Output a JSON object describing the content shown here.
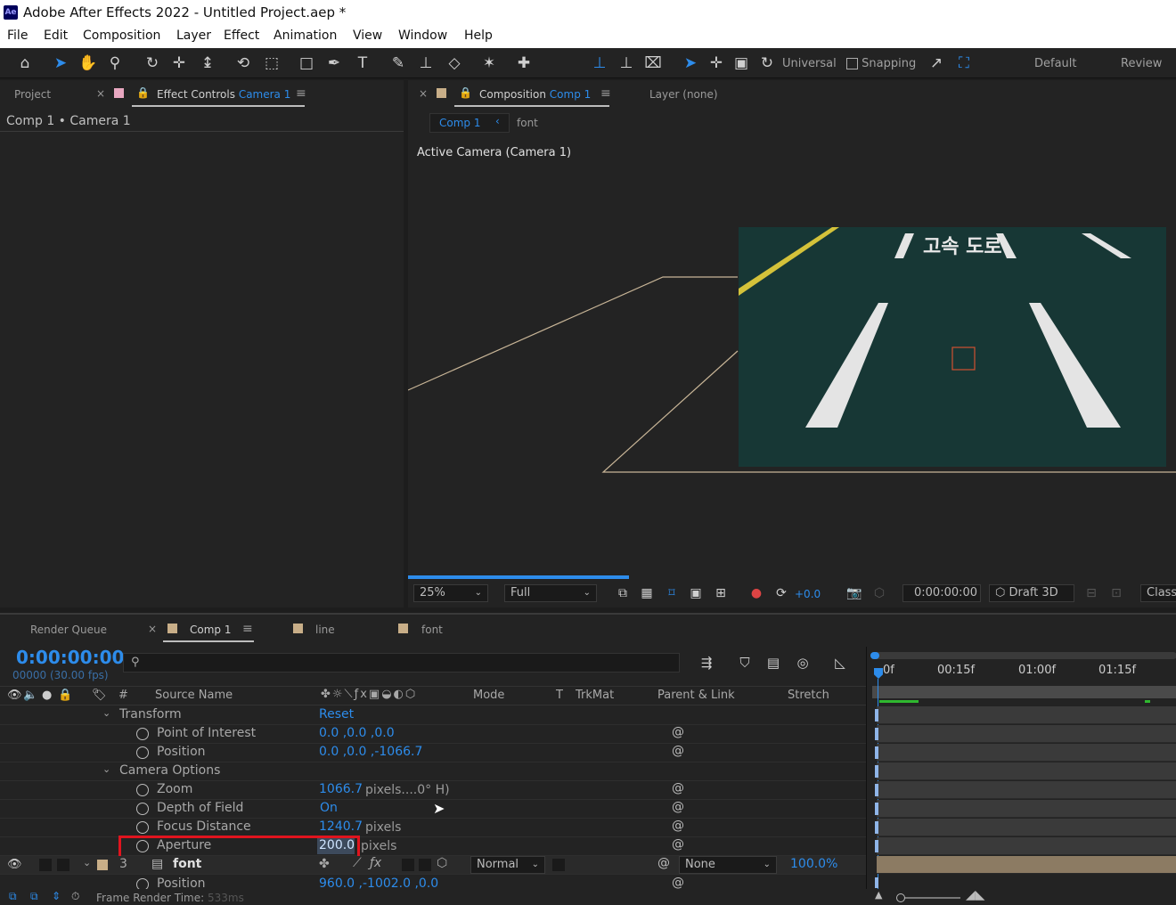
{
  "app": {
    "title": "Adobe After Effects 2022 - Untitled Project.aep *",
    "icon_label": "Ae"
  },
  "menu": [
    "File",
    "Edit",
    "Composition",
    "Layer",
    "Effect",
    "Animation",
    "View",
    "Window",
    "Help"
  ],
  "toolbar": {
    "universal_label": "Universal",
    "snapping_label": "Snapping",
    "workspaces": [
      "Default",
      "Review"
    ]
  },
  "left_panel": {
    "project_tab": "Project",
    "effect_controls_tab": "Effect Controls",
    "effect_controls_target": "Camera 1",
    "subtitle": "Comp 1 • Camera 1"
  },
  "comp_panel": {
    "tab_label": "Composition",
    "tab_target": "Comp 1",
    "layer_tab": "Layer (none)",
    "breadcrumb_active": "Comp 1",
    "breadcrumb_next": "font",
    "viewer_label": "Active Camera (Camera 1)",
    "road_text": "고속 도로",
    "zoom": "25%",
    "resolution": "Full",
    "exposure": "+0.0",
    "timecode": "0:00:00:00",
    "renderer": "Draft 3D",
    "classic_label": "Classi"
  },
  "timeline": {
    "tabs": {
      "render_queue": "Render Queue",
      "comp": "Comp 1",
      "line": "line",
      "font": "font"
    },
    "current_time": "0:00:00:00",
    "frame_info": "00000 (30.00 fps)",
    "columns": {
      "hash": "#",
      "source_name": "Source Name",
      "mode": "Mode",
      "t": "T",
      "trkmat": "TrkMat",
      "parent": "Parent & Link",
      "stretch": "Stretch"
    },
    "ruler": [
      "0f",
      "00:15f",
      "01:00f",
      "01:15f"
    ],
    "properties": [
      {
        "name": "Transform",
        "value": "Reset",
        "group": true
      },
      {
        "name": "Point of Interest",
        "value": "0.0 ,0.0 ,0.0"
      },
      {
        "name": "Position",
        "value": "0.0 ,0.0 ,-1066.7"
      },
      {
        "name": "Camera Options",
        "group": true
      },
      {
        "name": "Zoom",
        "value": "1066.7",
        "suffix": "pixels....0° H)"
      },
      {
        "name": "Depth of Field",
        "value": "On"
      },
      {
        "name": "Focus Distance",
        "value": "1240.7",
        "suffix": "pixels"
      },
      {
        "name": "Aperture",
        "value": "200.0",
        "suffix": "pixels",
        "highlight": true
      }
    ],
    "layer": {
      "number": "3",
      "name": "font",
      "mode": "Normal",
      "parent": "None",
      "stretch": "100.0%"
    },
    "next_property": {
      "name": "Position",
      "value": "960.0 ,-1002.0 ,0.0"
    },
    "status": "Frame Render Time:",
    "render_time": "533ms"
  },
  "colors": {
    "accent": "#2d8ceb",
    "highlight_box": "#e0141e",
    "road": "#173735",
    "camera_label": "#e8a7c0",
    "footage_label": "#c8ae88"
  }
}
